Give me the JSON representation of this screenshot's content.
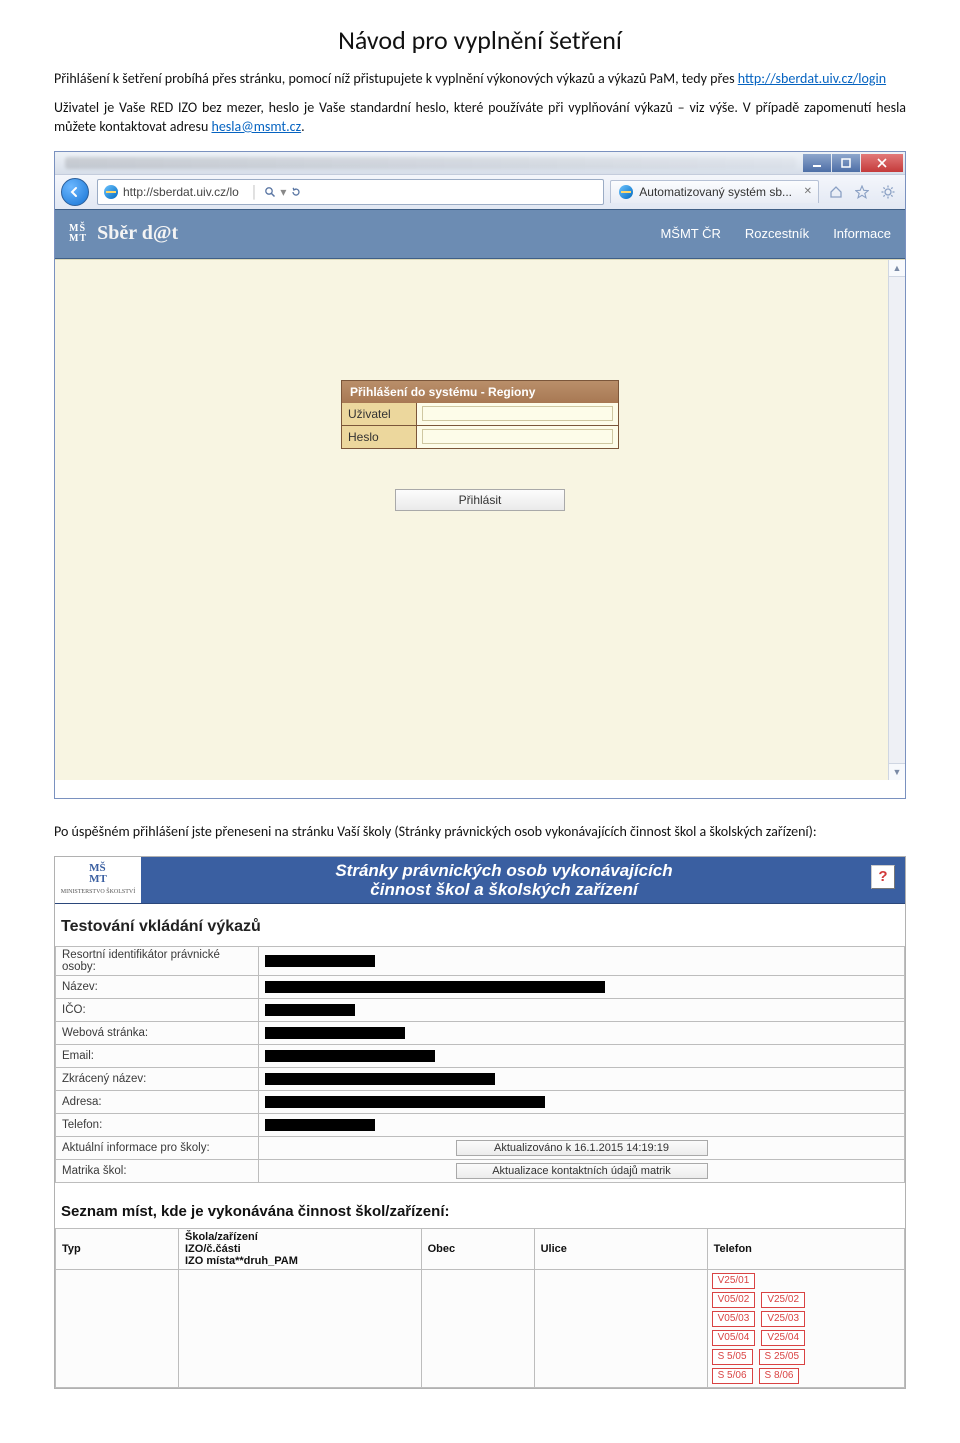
{
  "doc": {
    "title": "Návod pro vyplnění šetření",
    "para1_a": "Přihlášení k šetření probíhá přes stránku, pomocí níž přistupujete k vyplnění výkonových výkazů a výkazů PaM, tedy přes ",
    "link1": "http://sberdat.uiv.cz/login",
    "para2_a": "Uživatel je Vaše RED IZO bez mezer, heslo je Vaše standardní heslo, které používáte při vyplňování výkazů – viz výše. V případě zapomenutí hesla můžete kontaktovat adresu ",
    "link2": "hesla@msmt.cz",
    "para2_b": ".",
    "para3": "Po úspěšném přihlášení jste přeneseni na stránku Vaší školy (Stránky právnických osob vykonávajících činnost škol a školských zařízení):"
  },
  "browser": {
    "url": "http://sberdat.uiv.cz/lo",
    "search_hint": "▾",
    "tab_label": "Automatizovaný systém sb...",
    "app_title": "Sběr d@t",
    "nav": {
      "a": "MŠMT ČR",
      "b": "Rozcestník",
      "c": "Informace"
    },
    "login": {
      "title": "Přihlášení do systému - Regiony",
      "user_label": "Uživatel",
      "pass_label": "Heslo",
      "submit": "Přihlásit"
    }
  },
  "fig2": {
    "header_line1": "Stránky právnických osob vykonávajících",
    "header_line2": "činnost škol a školských zařízení",
    "logo_small": "MINISTERSTVO ŠKOLSTVÍ",
    "section": "Testování vkládání výkazů",
    "rows": {
      "r1": "Resortní identifikátor právnické osoby:",
      "r2": "Název:",
      "r3": "IČO:",
      "r4": "Webová stránka:",
      "r5": "Email:",
      "r6": "Zkrácený název:",
      "r7": "Adresa:",
      "r8": "Telefon:",
      "r9": "Aktuální informace pro školy:",
      "r10": "Matrika škol:"
    },
    "btn1": "Aktualizováno k 16.1.2015 14:19:19",
    "btn2": "Aktualizace kontaktních údajů matrik",
    "subhead": "Seznam míst, kde je vykonávána činnost škol/zařízení:",
    "th": {
      "c1": "Typ",
      "c2": "Škola/zařízení\nIZO/č.části\nIZO místa**druh_PAM",
      "c3": "Obec",
      "c4": "Ulice",
      "c5": "Telefon"
    },
    "tags": {
      "a": "V25/01",
      "b": "V05/02",
      "b2": "V25/02",
      "c": "V05/03",
      "c2": "V25/03",
      "d": "V05/04",
      "d2": "V25/04",
      "e": "S 5/05",
      "e2": "S 25/05",
      "f": "S 5/06",
      "f2": "S 8/06"
    }
  }
}
